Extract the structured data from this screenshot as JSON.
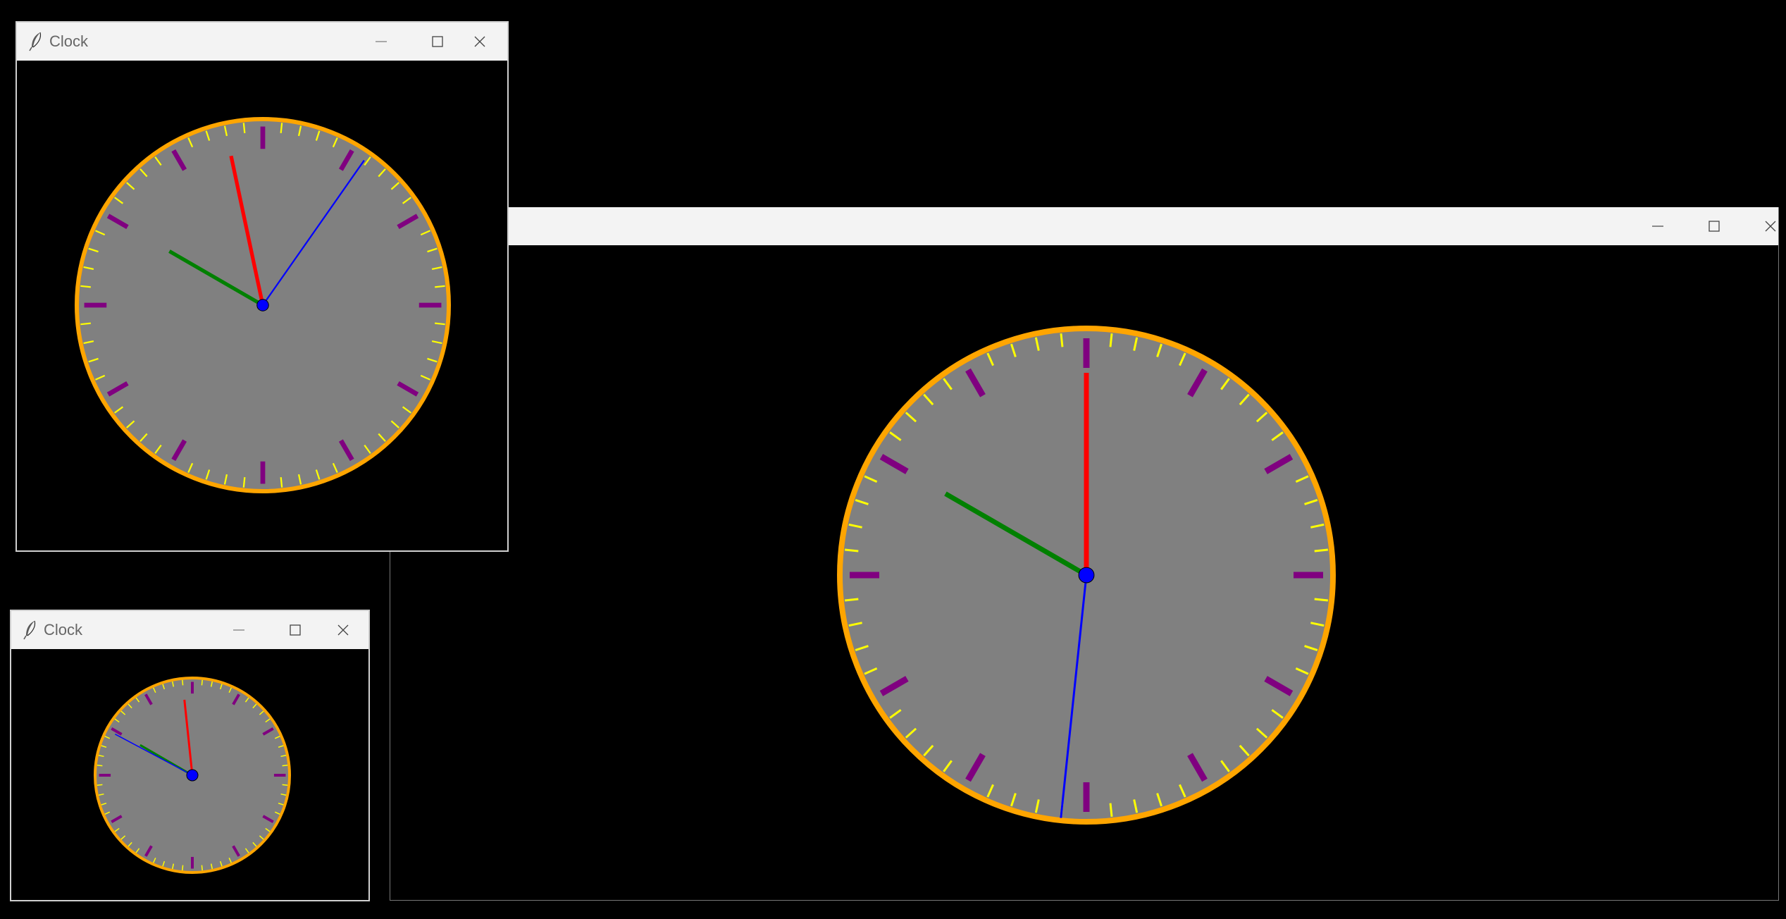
{
  "windows": {
    "top": {
      "title": "Clock",
      "icon": "tk-feather-icon",
      "clock": {
        "hour_deg": 300,
        "minute_deg": -12,
        "second_deg": 35
      }
    },
    "small": {
      "title": "Clock",
      "icon": "tk-feather-icon",
      "clock": {
        "hour_deg": 300,
        "minute_deg": -6,
        "second_deg": 298
      }
    },
    "big": {
      "title": "",
      "clock": {
        "hour_deg": 300,
        "minute_deg": 0,
        "second_deg": 186
      }
    }
  },
  "controls": {
    "minimize": "minimize-icon",
    "maximize": "maximize-icon",
    "close": "close-icon"
  },
  "colors": {
    "background": "#000000",
    "face": "#808080",
    "rim": "#FFA500",
    "minor_ticks": "#FFFF00",
    "major_ticks": "#800080",
    "hour_hand": "#008000",
    "minute_hand": "#FF0000",
    "second_hand": "#0000FF",
    "hub": "#0000FF",
    "titlebar": "#F3F3F3"
  }
}
